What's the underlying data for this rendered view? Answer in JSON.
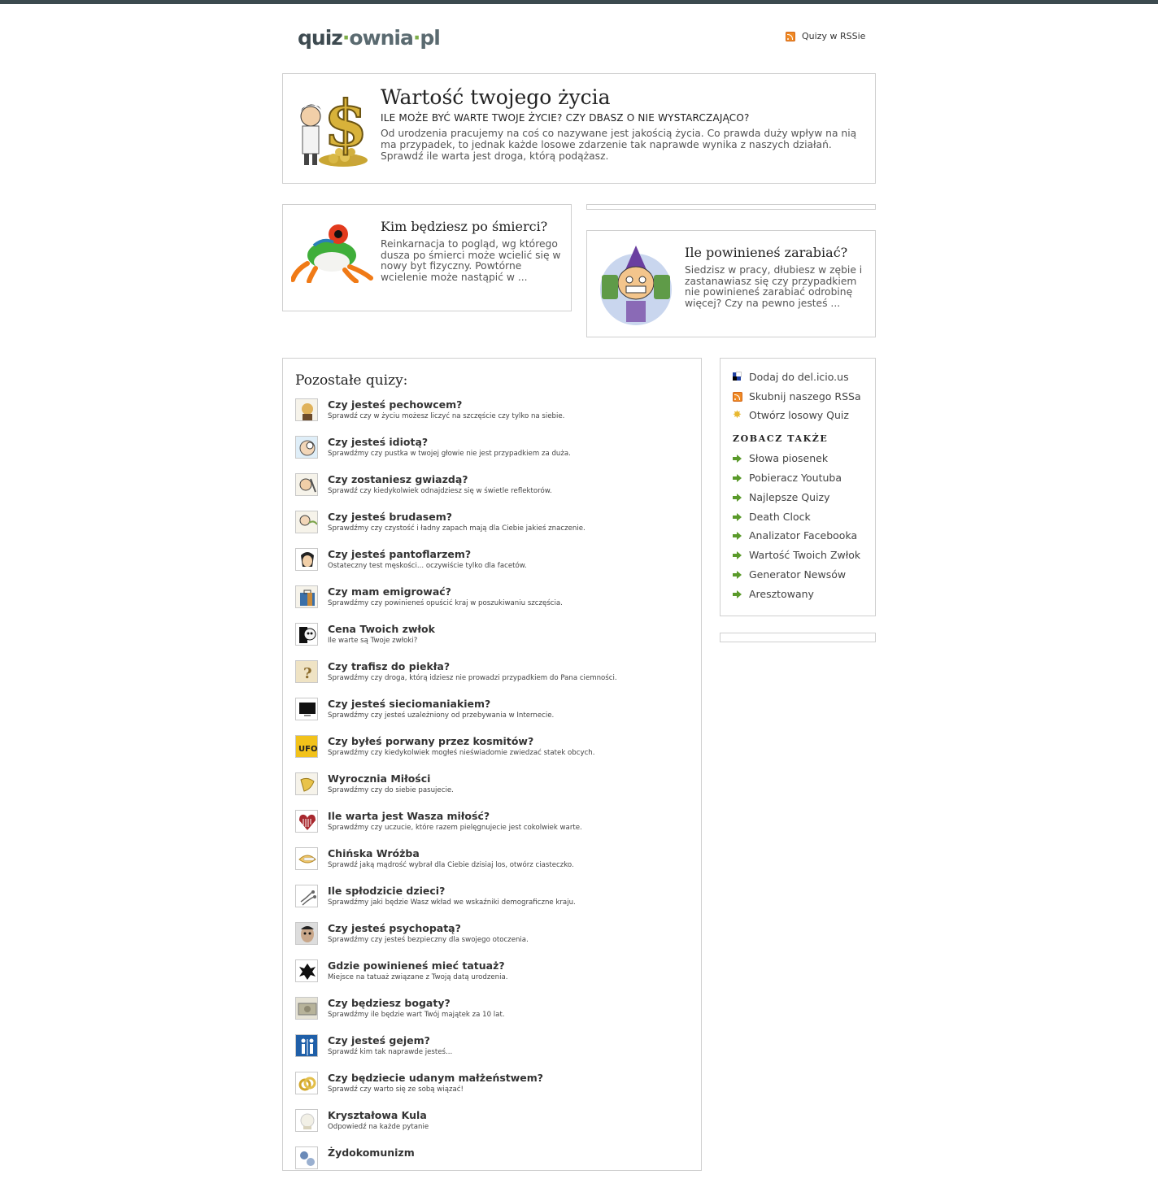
{
  "header": {
    "logo": {
      "part1": "quiz",
      "dot": "·",
      "part2": "ownia",
      "part3": "pl"
    },
    "rss_label": "Quizy w RSSie"
  },
  "featured": {
    "title": "Wartość twojego życia",
    "subtitle": "ILE MOŻE BYĆ WARTE TWOJE ŻYCIE? CZY DBASZ O NIE WYSTARCZAJĄCO?",
    "description": "Od urodzenia pracujemy na coś co nazywane jest jakością życia. Co prawda duży wpływ na nią ma przypadek, to jednak każde losowe zdarzenie tak naprawde wynika z naszych działań. Sprawdź ile warta jest droga, którą podążasz."
  },
  "cards": [
    {
      "title": "Kim będziesz po śmierci?",
      "description": "Reinkarnacja to pogląd, wg którego dusza po śmierci może wcielić się w nowy byt fizyczny. Powtórne wcielenie może nastąpić w ..."
    },
    {
      "title": "Ile powinieneś zarabiać?",
      "description": "Siedzisz w pracy, dłubiesz w zębie i zastanawiasz się czy przypadkiem nie powinieneś zarabiać odrobinę więcej? Czy na pewno jesteś ..."
    }
  ],
  "quiz_list": {
    "title": "Pozostałe quizy:",
    "items": [
      {
        "title": "Czy jesteś pechowcem?",
        "desc": "Sprawdź czy w życiu możesz liczyć na szczęście czy tylko na siebie."
      },
      {
        "title": "Czy jesteś idiotą?",
        "desc": "Sprawdźmy czy pustka w twojej głowie nie jest przypadkiem za duża."
      },
      {
        "title": "Czy zostaniesz gwiazdą?",
        "desc": "Sprawdź czy kiedykolwiek odnajdziesz się w świetle reflektorów."
      },
      {
        "title": "Czy jesteś brudasem?",
        "desc": "Sprawdźmy czy czystość i ładny zapach mają dla Ciebie jakieś znaczenie."
      },
      {
        "title": "Czy jesteś pantoflarzem?",
        "desc": "Ostateczny test męskości... oczywiście tylko dla facetów."
      },
      {
        "title": "Czy mam emigrować?",
        "desc": "Sprawdźmy czy powinieneś opuścić kraj w poszukiwaniu szczęścia."
      },
      {
        "title": "Cena Twoich zwłok",
        "desc": "Ile warte są Twoje zwłoki?"
      },
      {
        "title": "Czy trafisz do piekła?",
        "desc": "Sprawdźmy czy droga, którą idziesz nie prowadzi przypadkiem do Pana ciemności."
      },
      {
        "title": "Czy jesteś sieciomaniakiem?",
        "desc": "Sprawdźmy czy jesteś uzależniony od przebywania w Internecie."
      },
      {
        "title": "Czy byłeś porwany przez kosmitów?",
        "desc": "Sprawdźmy czy kiedykolwiek mogłeś nieświadomie zwiedzać statek obcych."
      },
      {
        "title": "Wyrocznia Miłości",
        "desc": "Sprawdźmy czy do siebie pasujecie."
      },
      {
        "title": "Ile warta jest Wasza miłość?",
        "desc": "Sprawdźmy czy uczucie, które razem pielęgnujecie jest cokolwiek warte."
      },
      {
        "title": "Chińska Wróżba",
        "desc": "Sprawdź jaką mądrość wybrał dla Ciebie dzisiaj los, otwórz ciasteczko."
      },
      {
        "title": "Ile spłodzicie dzieci?",
        "desc": "Sprawdźmy jaki będzie Wasz wkład we wskaźniki demograficzne kraju."
      },
      {
        "title": "Czy jesteś psychopatą?",
        "desc": "Sprawdźmy czy jesteś bezpieczny dla swojego otoczenia."
      },
      {
        "title": "Gdzie powinieneś mieć tatuaż?",
        "desc": "Miejsce na tatuaż związane z Twoją datą urodzenia."
      },
      {
        "title": "Czy będziesz bogaty?",
        "desc": "Sprawdźmy ile będzie wart Twój majątek za 10 lat."
      },
      {
        "title": "Czy jesteś gejem?",
        "desc": "Sprawdź kim tak naprawde jesteś..."
      },
      {
        "title": "Czy będziecie udanym małżeństwem?",
        "desc": "Sprawdź czy warto się ze sobą wiązać!"
      },
      {
        "title": "Kryształowa Kula",
        "desc": "Odpowiedź na każde pytanie"
      },
      {
        "title": "Żydokomunizm",
        "desc": ""
      }
    ]
  },
  "icon_text": {
    "ufo": "UFO"
  },
  "sidebar": {
    "actions": [
      {
        "label": "Dodaj do del.icio.us",
        "icon": "delicious-icon"
      },
      {
        "label": "Skubnij naszego RSSa",
        "icon": "rss-icon"
      },
      {
        "label": "Otwórz losowy Quiz",
        "icon": "star-icon"
      }
    ],
    "see_also_title": "ZOBACZ TAKŻE",
    "links": [
      "Słowa piosenek",
      "Pobieracz Youtuba",
      "Najlepsze Quizy",
      "Death Clock",
      "Analizator Facebooka",
      "Wartość Twoich Zwłok",
      "Generator Newsów",
      "Aresztowany"
    ]
  },
  "colors": {
    "topbar": "#3c4a4f",
    "accent_green": "#5a9a2a",
    "rss_orange": "#f08a24",
    "border": "#cfcfcf"
  }
}
